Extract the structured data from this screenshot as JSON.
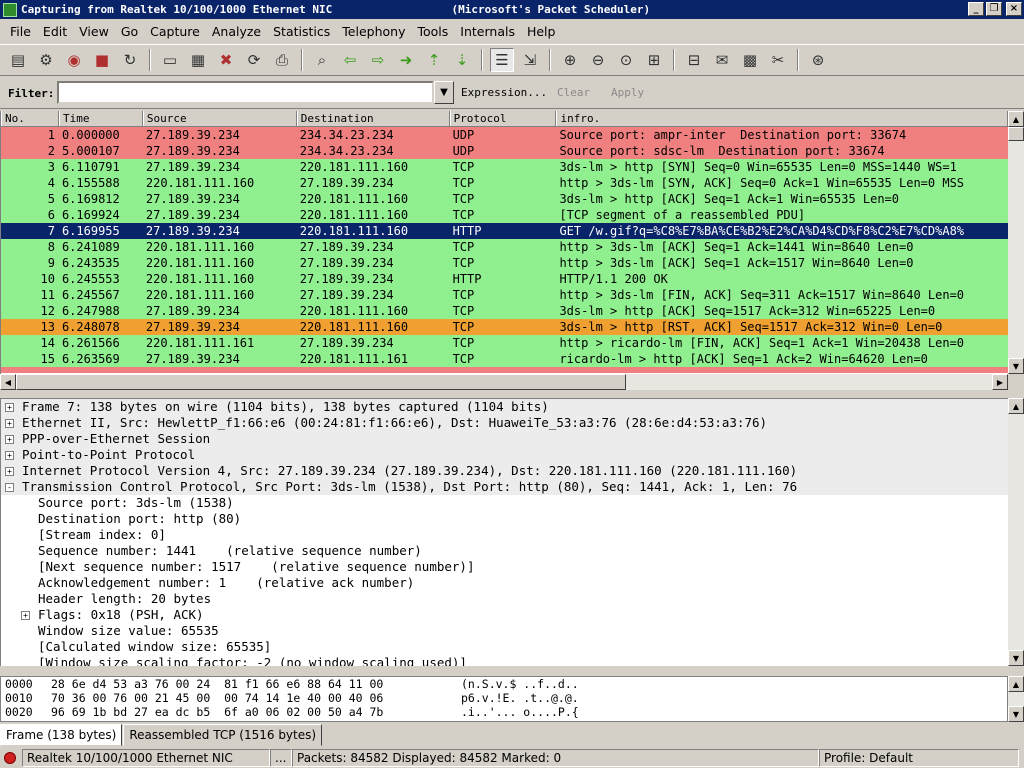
{
  "window": {
    "title": "Capturing from Realtek 10/100/1000 Ethernet NIC                  (Microsoft's Packet Scheduler)"
  },
  "menu": [
    "File",
    "Edit",
    "View",
    "Go",
    "Capture",
    "Analyze",
    "Statistics",
    "Telephony",
    "Tools",
    "Internals",
    "Help"
  ],
  "filter": {
    "label": "Filter:",
    "value": "",
    "expression": "Expression...",
    "clear": "Clear",
    "apply": "Apply"
  },
  "colors": {
    "udp_red": "#f08080",
    "tcp_green": "#90f090",
    "selected": "#0a246a",
    "rst_orange": "#f0a030"
  },
  "packet_list": {
    "columns": [
      "No.",
      "Time",
      "Source",
      "Destination",
      "Protocol",
      "infro."
    ],
    "rows": [
      {
        "no": "1",
        "time": "0.000000",
        "src": "27.189.39.234",
        "dst": "234.34.23.234",
        "proto": "UDP",
        "info": "Source port: ampr-inter  Destination port: 33674",
        "bg": "#f08080",
        "fg": "#000"
      },
      {
        "no": "2",
        "time": "5.000107",
        "src": "27.189.39.234",
        "dst": "234.34.23.234",
        "proto": "UDP",
        "info": "Source port: sdsc-lm  Destination port: 33674",
        "bg": "#f08080",
        "fg": "#000"
      },
      {
        "no": "3",
        "time": "6.110791",
        "src": "27.189.39.234",
        "dst": "220.181.111.160",
        "proto": "TCP",
        "info": "3ds-lm > http [SYN] Seq=0 Win=65535 Len=0 MSS=1440 WS=1",
        "bg": "#90f090",
        "fg": "#000"
      },
      {
        "no": "4",
        "time": "6.155588",
        "src": "220.181.111.160",
        "dst": "27.189.39.234",
        "proto": "TCP",
        "info": "http > 3ds-lm [SYN, ACK] Seq=0 Ack=1 Win=65535 Len=0 MSS",
        "bg": "#90f090",
        "fg": "#000"
      },
      {
        "no": "5",
        "time": "6.169812",
        "src": "27.189.39.234",
        "dst": "220.181.111.160",
        "proto": "TCP",
        "info": "3ds-lm > http [ACK] Seq=1 Ack=1 Win=65535 Len=0",
        "bg": "#90f090",
        "fg": "#000"
      },
      {
        "no": "6",
        "time": "6.169924",
        "src": "27.189.39.234",
        "dst": "220.181.111.160",
        "proto": "TCP",
        "info": "[TCP segment of a reassembled PDU]",
        "bg": "#90f090",
        "fg": "#000"
      },
      {
        "no": "7",
        "time": "6.169955",
        "src": "27.189.39.234",
        "dst": "220.181.111.160",
        "proto": "HTTP",
        "info": "GET /w.gif?q=%C8%E7%BA%CE%B2%E2%CA%D4%CD%F8%C2%E7%CD%A8%",
        "bg": "#0a246a",
        "fg": "#fff"
      },
      {
        "no": "8",
        "time": "6.241089",
        "src": "220.181.111.160",
        "dst": "27.189.39.234",
        "proto": "TCP",
        "info": "http > 3ds-lm [ACK] Seq=1 Ack=1441 Win=8640 Len=0",
        "bg": "#90f090",
        "fg": "#000"
      },
      {
        "no": "9",
        "time": "6.243535",
        "src": "220.181.111.160",
        "dst": "27.189.39.234",
        "proto": "TCP",
        "info": "http > 3ds-lm [ACK] Seq=1 Ack=1517 Win=8640 Len=0",
        "bg": "#90f090",
        "fg": "#000"
      },
      {
        "no": "10",
        "time": "6.245553",
        "src": "220.181.111.160",
        "dst": "27.189.39.234",
        "proto": "HTTP",
        "info": "HTTP/1.1 200 OK",
        "bg": "#90f090",
        "fg": "#000"
      },
      {
        "no": "11",
        "time": "6.245567",
        "src": "220.181.111.160",
        "dst": "27.189.39.234",
        "proto": "TCP",
        "info": "http > 3ds-lm [FIN, ACK] Seq=311 Ack=1517 Win=8640 Len=0",
        "bg": "#90f090",
        "fg": "#000"
      },
      {
        "no": "12",
        "time": "6.247988",
        "src": "27.189.39.234",
        "dst": "220.181.111.160",
        "proto": "TCP",
        "info": "3ds-lm > http [ACK] Seq=1517 Ack=312 Win=65225 Len=0",
        "bg": "#90f090",
        "fg": "#000"
      },
      {
        "no": "13",
        "time": "6.248078",
        "src": "27.189.39.234",
        "dst": "220.181.111.160",
        "proto": "TCP",
        "info": "3ds-lm > http [RST, ACK] Seq=1517 Ack=312 Win=0 Len=0",
        "bg": "#f0a030",
        "fg": "#000"
      },
      {
        "no": "14",
        "time": "6.261566",
        "src": "220.181.111.161",
        "dst": "27.189.39.234",
        "proto": "TCP",
        "info": "http > ricardo-lm [FIN, ACK] Seq=1 Ack=1 Win=20438 Len=0",
        "bg": "#90f090",
        "fg": "#000"
      },
      {
        "no": "15",
        "time": "6.263569",
        "src": "27.189.39.234",
        "dst": "220.181.111.161",
        "proto": "TCP",
        "info": "ricardo-lm > http [ACK] Seq=1 Ack=2 Win=64620 Len=0",
        "bg": "#90f090",
        "fg": "#000"
      }
    ]
  },
  "details": [
    {
      "text": "Frame 7: 138 bytes on wire (1104 bits), 138 bytes captured (1104 bits)",
      "exp": "+",
      "top": true
    },
    {
      "text": "Ethernet II, Src: HewlettP_f1:66:e6 (00:24:81:f1:66:e6), Dst: HuaweiTe_53:a3:76 (28:6e:d4:53:a3:76)",
      "exp": "+",
      "top": true
    },
    {
      "text": "PPP-over-Ethernet Session",
      "exp": "+",
      "top": true
    },
    {
      "text": "Point-to-Point Protocol",
      "exp": "+",
      "top": true
    },
    {
      "text": "Internet Protocol Version 4, Src: 27.189.39.234 (27.189.39.234), Dst: 220.181.111.160 (220.181.111.160)",
      "exp": "+",
      "top": true
    },
    {
      "text": "Transmission Control Protocol, Src Port: 3ds-lm (1538), Dst Port: http (80), Seq: 1441, Ack: 1, Len: 76",
      "exp": "-",
      "top": true
    },
    {
      "text": "Source port: 3ds-lm (1538)",
      "exp": "",
      "top": false
    },
    {
      "text": "Destination port: http (80)",
      "exp": "",
      "top": false
    },
    {
      "text": "[Stream index: 0]",
      "exp": "",
      "top": false
    },
    {
      "text": "Sequence number: 1441    (relative sequence number)",
      "exp": "",
      "top": false
    },
    {
      "text": "[Next sequence number: 1517    (relative sequence number)]",
      "exp": "",
      "top": false
    },
    {
      "text": "Acknowledgement number: 1    (relative ack number)",
      "exp": "",
      "top": false
    },
    {
      "text": "Header length: 20 bytes",
      "exp": "",
      "top": false
    },
    {
      "text": "Flags: 0x18 (PSH, ACK)",
      "exp": "+",
      "top": false
    },
    {
      "text": "Window size value: 65535",
      "exp": "",
      "top": false
    },
    {
      "text": "[Calculated window size: 65535]",
      "exp": "",
      "top": false
    },
    {
      "text": "[Window size scaling factor: -2 (no window scaling used)]",
      "exp": "",
      "top": false
    }
  ],
  "hex": [
    {
      "off": "0000",
      "hex": "28 6e d4 53 a3 76 00 24  81 f1 66 e6 88 64 11 00",
      "ascii": "(n.S.v.$ ..f..d.."
    },
    {
      "off": "0010",
      "hex": "70 36 00 76 00 21 45 00  00 74 14 1e 40 00 40 06",
      "ascii": "p6.v.!E. .t..@.@."
    },
    {
      "off": "0020",
      "hex": "96 69 1b bd 27 ea dc b5  6f a0 06 02 00 50 a4 7b",
      "ascii": ".i..'... o....P.{"
    }
  ],
  "tabs": [
    "Frame (138 bytes)",
    "Reassembled TCP (1516 bytes)"
  ],
  "status": {
    "nic": "Realtek 10/100/1000 Ethernet NIC",
    "dots": "...",
    "packets": "Packets: 84582 Displayed: 84582 Marked: 0",
    "profile": "Profile: Default"
  },
  "toolbar_icons": [
    "list-interfaces-icon",
    "capture-options-icon",
    "start-capture-icon",
    "stop-capture-icon",
    "restart-capture-icon",
    "open-file-icon",
    "save-file-icon",
    "close-file-icon",
    "reload-icon",
    "print-icon",
    "find-icon",
    "back-icon",
    "forward-icon",
    "goto-icon",
    "first-packet-icon",
    "last-packet-icon",
    "colorize-icon",
    "autoscroll-icon",
    "zoom-in-icon",
    "zoom-out-icon",
    "normal-size-icon",
    "resize-columns-icon",
    "capture-filters-icon",
    "display-filters-icon",
    "coloring-rules-icon",
    "preferences-icon",
    "help-icon"
  ]
}
